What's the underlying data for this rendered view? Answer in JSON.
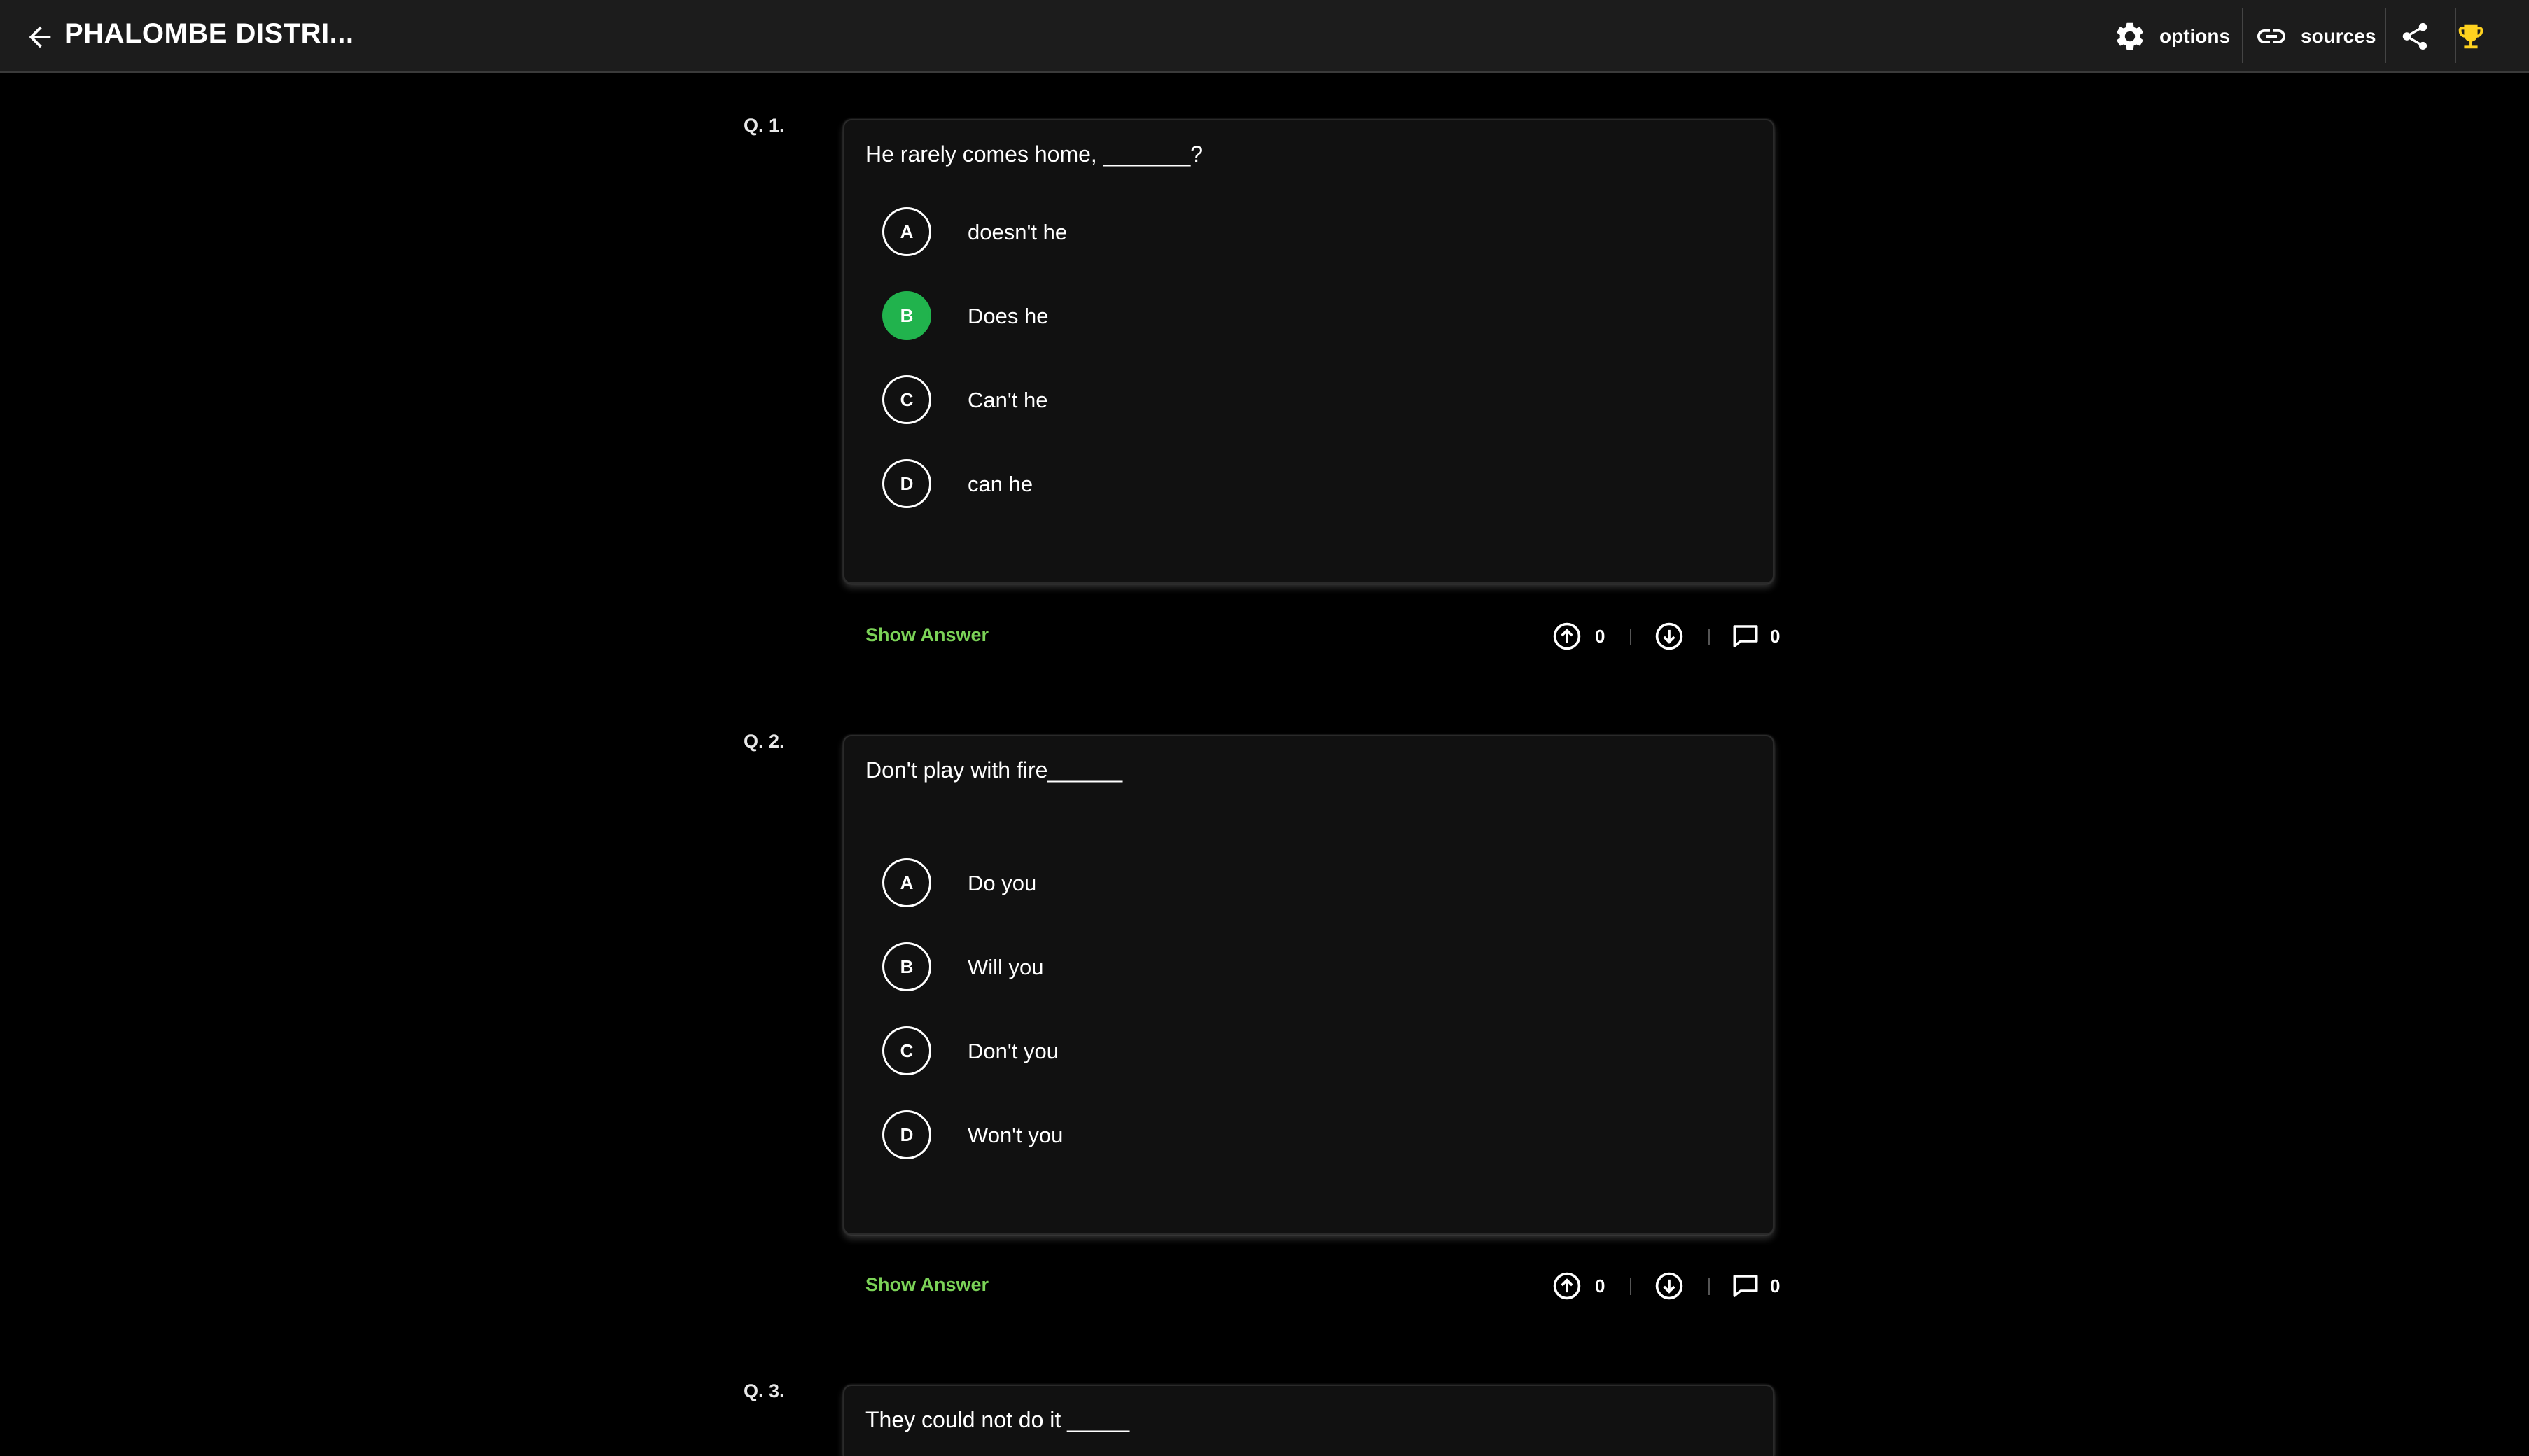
{
  "header": {
    "title": "PHALOMBE DISTRI...",
    "options_label": "options",
    "sources_label": "sources",
    "icons": [
      "arrow-left-icon",
      "gear-icon",
      "link-icon",
      "share-icon",
      "trophy-icon"
    ],
    "trophy_color": "#ffd21f"
  },
  "colors": {
    "background": "#000000",
    "card": "#111111",
    "correct": "#21b34d",
    "show_answer": "#7bd257"
  },
  "questions": [
    {
      "number": "Q. 1.",
      "text": "He rarely comes home, _______?",
      "options": [
        {
          "letter": "A",
          "text": "doesn't he",
          "correct": false
        },
        {
          "letter": "B",
          "text": "Does he",
          "correct": true
        },
        {
          "letter": "C",
          "text": "Can't he",
          "correct": false
        },
        {
          "letter": "D",
          "text": "can he",
          "correct": false
        }
      ],
      "show_answer": "Show Answer",
      "upvotes": "0",
      "comments": "0"
    },
    {
      "number": "Q. 2.",
      "text": "Don't  play with fire______",
      "options": [
        {
          "letter": "A",
          "text": "Do you",
          "correct": false
        },
        {
          "letter": "B",
          "text": "Will you",
          "correct": false
        },
        {
          "letter": "C",
          "text": "Don't you",
          "correct": false
        },
        {
          "letter": "D",
          "text": "Won't you",
          "correct": false
        }
      ],
      "show_answer": "Show Answer",
      "upvotes": "0",
      "comments": "0"
    },
    {
      "number": "Q. 3.",
      "text": "They could not do it _____"
    }
  ]
}
